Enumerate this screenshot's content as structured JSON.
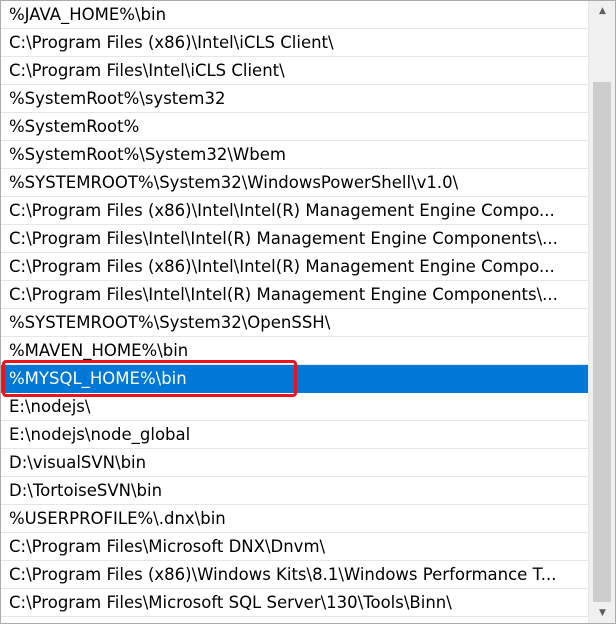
{
  "path_list": {
    "items": [
      "%JAVA_HOME%\\bin",
      "C:\\Program Files (x86)\\Intel\\iCLS Client\\",
      "C:\\Program Files\\Intel\\iCLS Client\\",
      "%SystemRoot%\\system32",
      "%SystemRoot%",
      "%SystemRoot%\\System32\\Wbem",
      "%SYSTEMROOT%\\System32\\WindowsPowerShell\\v1.0\\",
      "C:\\Program Files (x86)\\Intel\\Intel(R) Management Engine Compo...",
      "C:\\Program Files\\Intel\\Intel(R) Management Engine Components\\...",
      "C:\\Program Files (x86)\\Intel\\Intel(R) Management Engine Compo...",
      "C:\\Program Files\\Intel\\Intel(R) Management Engine Components\\...",
      "%SYSTEMROOT%\\System32\\OpenSSH\\",
      "%MAVEN_HOME%\\bin",
      "%MYSQL_HOME%\\bin",
      "E:\\nodejs\\",
      "E:\\nodejs\\node_global",
      "D:\\visualSVN\\bin",
      "D:\\TortoiseSVN\\bin",
      "%USERPROFILE%\\.dnx\\bin",
      "C:\\Program Files\\Microsoft DNX\\Dnvm\\",
      "C:\\Program Files (x86)\\Windows Kits\\8.1\\Windows Performance T...",
      "C:\\Program Files\\Microsoft SQL Server\\130\\Tools\\Binn\\"
    ],
    "selected_index": 13,
    "scroll_position": 0.14
  },
  "icons": {
    "scroll_up": "scroll-up-arrow-icon",
    "scroll_down": "scroll-down-arrow-icon"
  },
  "colors": {
    "selection": "#0078d7",
    "annotation": "#e8151c",
    "row_divider": "#e6e6e6"
  }
}
